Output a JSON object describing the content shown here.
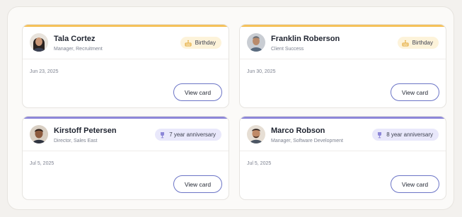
{
  "cards": [
    {
      "name": "Tala Cortez",
      "role": "Manager, Recruitment",
      "badge": "Birthday",
      "badge_icon": "cake-icon",
      "type": "birthday",
      "date": "Jun 23, 2025",
      "button": "View card"
    },
    {
      "name": "Franklin Roberson",
      "role": "Client Success",
      "badge": "Birthday",
      "badge_icon": "cake-icon",
      "type": "birthday",
      "date": "Jun 30, 2025",
      "button": "View card"
    },
    {
      "name": "Kirstoff Petersen",
      "role": "Director, Sales East",
      "badge": "7 year anniversary",
      "badge_icon": "trophy-icon",
      "type": "anniversary",
      "date": "Jul 5, 2025",
      "button": "View card"
    },
    {
      "name": "Marco Robson",
      "role": "Manager, Software Development",
      "badge": "8 year anniversary",
      "badge_icon": "trophy-icon",
      "type": "anniversary",
      "date": "Jul 5, 2025",
      "button": "View card"
    }
  ],
  "colors": {
    "birthday_accent": "#f5c15a",
    "anniversary_accent": "#8d87d8",
    "button_border": "#6b74c6"
  }
}
